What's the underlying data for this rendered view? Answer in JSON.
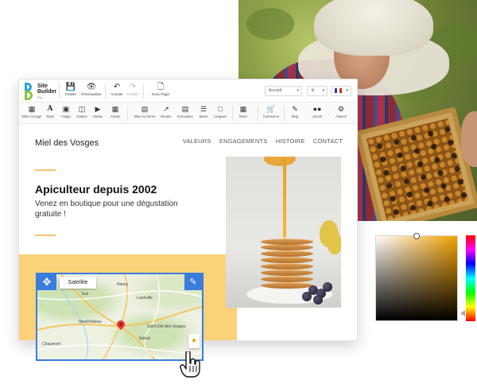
{
  "builder": {
    "logo": {
      "line1": "Site",
      "line2": "Builder",
      "tag": "Pro"
    },
    "topbar": {
      "publish": "Publier",
      "preview": "Prévisualiser",
      "undo": "Annuler",
      "redo": "Rétablir",
      "new_page": "Nouv.Page",
      "page_select": "Accueil"
    },
    "tools": [
      {
        "label": "Mise en page",
        "icon": "layout-icon"
      },
      {
        "label": "Texte",
        "icon": "text-icon"
      },
      {
        "label": "Image",
        "icon": "image-icon"
      },
      {
        "label": "Galerie",
        "icon": "gallery-icon"
      },
      {
        "label": "Media",
        "icon": "media-icon"
      },
      {
        "label": "Cartes",
        "icon": "map-icon"
      },
      {
        "label": "Mise en forme",
        "icon": "style-icon"
      },
      {
        "label": "Bouton",
        "icon": "button-icon"
      },
      {
        "label": "Formulaire",
        "icon": "form-icon"
      },
      {
        "label": "Menu",
        "icon": "menu-icon"
      },
      {
        "label": "Langues",
        "icon": "languages-icon"
      },
      {
        "label": "Blocs",
        "icon": "blocks-icon"
      },
      {
        "label": "Commerce",
        "icon": "cart-icon"
      },
      {
        "label": "Blog",
        "icon": "blog-icon"
      },
      {
        "label": "Social",
        "icon": "social-icon"
      },
      {
        "label": "Avancé",
        "icon": "advanced-icon"
      }
    ]
  },
  "site": {
    "brand": "Miel des Vosges",
    "nav": [
      "VALEURS",
      "ENGAGEMENTS",
      "HISTOIRE",
      "CONTACT"
    ],
    "hero_title": "Apiculteur depuis 2002",
    "hero_subtitle": "Venez en boutique pour une dégustation gratuite !"
  },
  "map": {
    "satellite_label": "Satellite",
    "towns": [
      "Nancy",
      "Lunéville",
      "Neufchâteau",
      "Saint-Dié-des-Vosges",
      "Épinal",
      "Chaumont",
      "Toul"
    ]
  },
  "colors": {
    "accent": "#f5c36a",
    "band": "#fbd27a",
    "map_edit": "#3b7ddd"
  }
}
